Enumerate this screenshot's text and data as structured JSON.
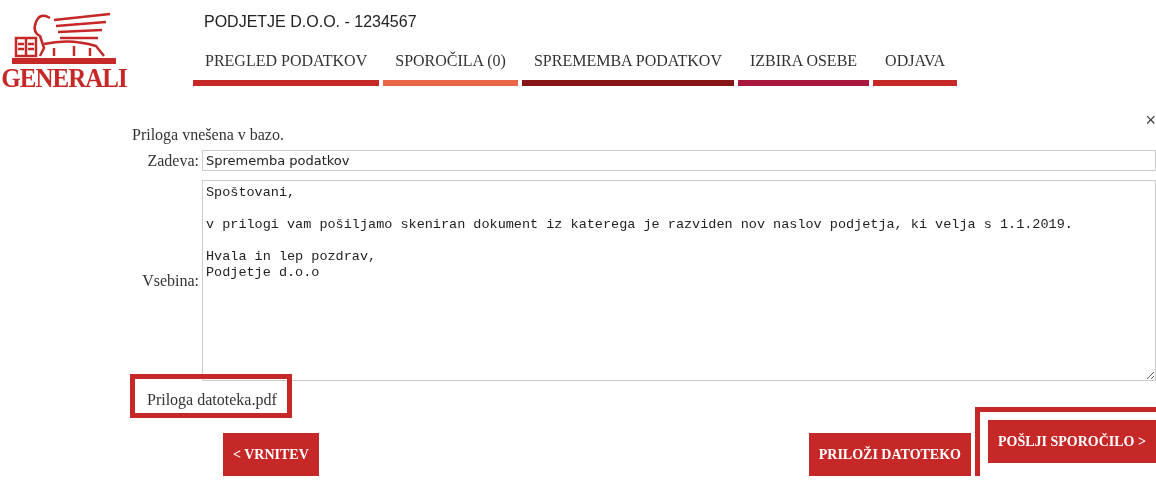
{
  "logo": {
    "text": "GENERALI"
  },
  "company": "PODJETJE D.O.O. - 1234567",
  "nav": [
    {
      "label": "PREGLED PODATKOV",
      "color": "#c62828"
    },
    {
      "label": "SPOROČILA (0)",
      "color": "#ea6649"
    },
    {
      "label": "SPREMEMBA PODATKOV",
      "color": "#861616"
    },
    {
      "label": "IZBIRA OSEBE",
      "color": "#a8183c"
    },
    {
      "label": "ODJAVA",
      "color": "#c62828"
    }
  ],
  "notice": "Priloga vnešena v bazo.",
  "close": "×",
  "subject": {
    "label": "Zadeva:",
    "value": "Sprememba podatkov"
  },
  "body": {
    "label": "Vsebina:",
    "value": "Spoštovani,\n\nv prilogi vam pošiljamo skeniran dokument iz katerega je razviden nov naslov podjetja, ki velja s 1.1.2019.\n\nHvala in lep pozdrav,\nPodjetje d.o.o"
  },
  "attachment": {
    "label": "Priloga",
    "file": "datoteka.pdf",
    "highlighted": true
  },
  "buttons": [
    {
      "label": "< VRNITEV",
      "kind": "back",
      "highlighted": false
    },
    {
      "label": "PRILOŽI DATOTEKO",
      "kind": "action",
      "highlighted": false
    },
    {
      "label": "POŠLJI SPOROČILO >",
      "kind": "action",
      "highlighted": true
    }
  ]
}
